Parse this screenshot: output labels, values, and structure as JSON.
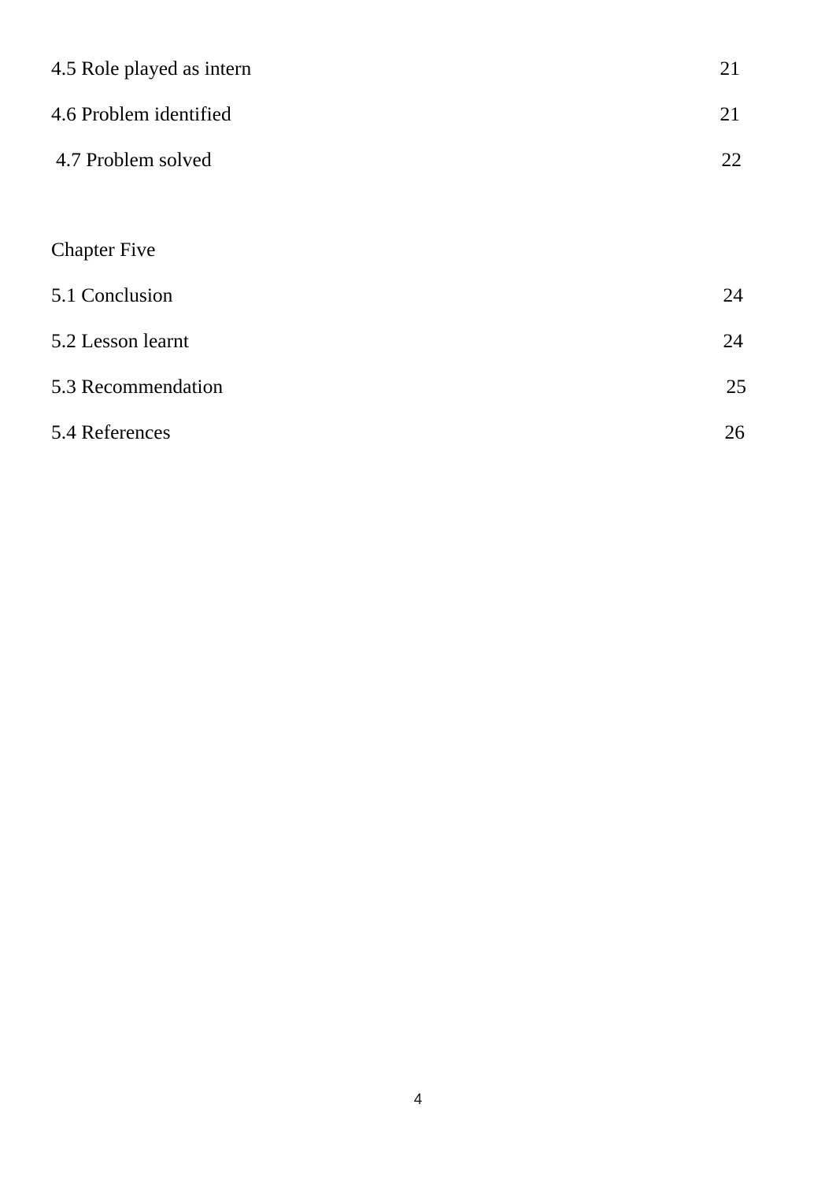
{
  "document": {
    "page_number": "4",
    "background_color": "#ffffff",
    "text_color": "#000000"
  },
  "toc": {
    "chapter_four_entries": [
      {
        "label": "4.5 Role played as intern",
        "page": "21"
      },
      {
        "label": "4.6 Problem identified",
        "page": "21"
      },
      {
        "label": " 4.7 Problem solved",
        "page": "22"
      }
    ],
    "chapter_five_heading": "Chapter Five",
    "chapter_five_entries": [
      {
        "label": "5.1 Conclusion",
        "page": "24"
      },
      {
        "label": "5.2 Lesson learnt",
        "page": "24"
      },
      {
        "label": "5.3 Recommendation",
        "page": "25"
      },
      {
        "label": "5.4 References",
        "page": "26"
      }
    ]
  }
}
